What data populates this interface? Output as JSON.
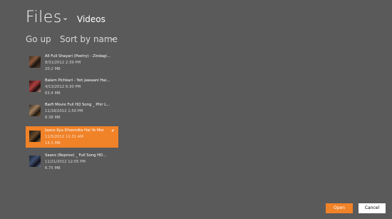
{
  "header": {
    "title": "Files",
    "location": "Videos"
  },
  "toolbar": {
    "go_up_label": "Go up",
    "sort_label": "Sort by name"
  },
  "files": [
    {
      "name": "All Full Shayari (Poetry) - Zindagi...",
      "date": "8/31/2012 2:39 PM",
      "size": "20.2 MB",
      "selected": false
    },
    {
      "name": "Balam Pichkari - Yeh Jawaani Hai...",
      "date": "4/13/2012 6:30 PM",
      "size": "63.4 MB",
      "selected": false
    },
    {
      "name": "Barfi Movie Full HQ Song _ Phir L...",
      "date": "11/18/2012 1:50 PM",
      "size": "8.38 MB",
      "selected": false
    },
    {
      "name": "Jaane Kya Dhoondta Hai Ye Mer",
      "date": "11/5/2012 11:31 AM",
      "size": "14.3 MB",
      "selected": true
    },
    {
      "name": "Saans (Reprise) _ Full Song HD...",
      "date": "11/21/2012 12:05 PM",
      "size": "6.75 MB",
      "selected": false
    }
  ],
  "icons": {
    "title_chevron": "chevron-down-icon",
    "sort_chevron": "chevron-down-icon",
    "check": "checkmark-icon"
  },
  "colors": {
    "background": "#5a5a5a",
    "accent": "#f08228"
  },
  "buttons": {
    "open_label": "Open",
    "cancel_label": "Cancel"
  }
}
